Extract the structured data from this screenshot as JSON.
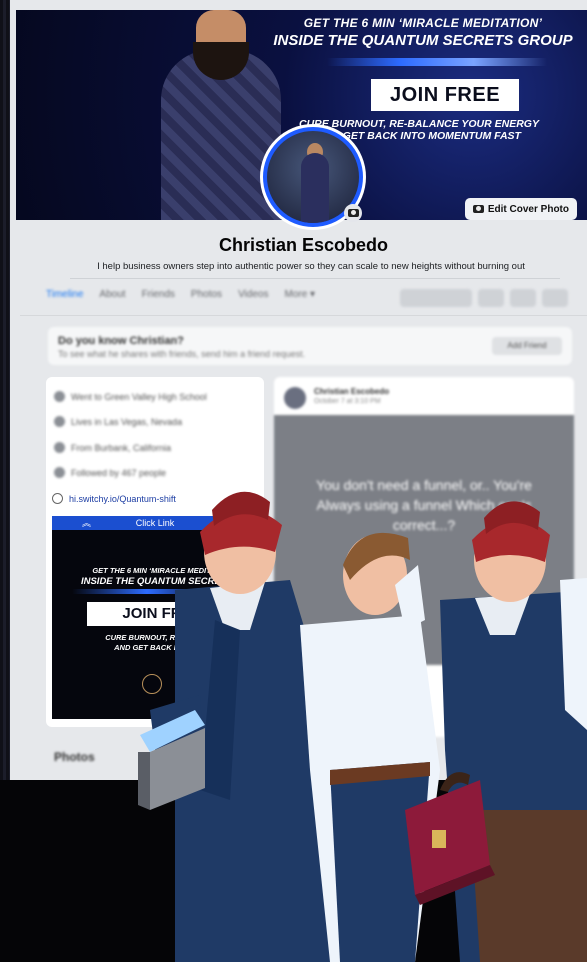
{
  "cover": {
    "headline_line1": "GET THE 6 MIN ‘MIRACLE MEDITATION’",
    "headline_line2_prefix": "INSIDE THE ",
    "headline_line2_highlight": "QUANTUM SECRETS GROUP",
    "join_label": "JOIN FREE",
    "sub_line1": "CURE BURNOUT, RE-BALANCE YOUR ENERGY",
    "sub_line2_prefix": "AND GET BACK INTO ",
    "sub_line2_highlight": "MOMENTUM FAST",
    "edit_button_label": "Edit Cover Photo"
  },
  "profile": {
    "name": "Christian Escobedo",
    "bio": "I help business owners step into authentic power so they can scale to new heights without burning out"
  },
  "tabs": [
    "Timeline",
    "About",
    "Friends",
    "Photos",
    "Videos",
    "More ▾"
  ],
  "know_card": {
    "title": "Do you know Christian?",
    "subtitle": "To see what he shares with friends, send him a friend request.",
    "button": "Add Friend"
  },
  "intro": {
    "items": [
      "Went to Green Valley High School",
      "Lives in Las Vegas, Nevada",
      "From Burbank, California",
      "Followed by 467 people"
    ],
    "link": "hi.switchy.io/Quantum-shift"
  },
  "promo": {
    "bar_label": "Click Link",
    "line1": "GET THE 6 MIN ‘MIRACLE MEDITATI",
    "line2": "INSIDE THE QUANTUM SECRETS G",
    "join_label": "JOIN FR",
    "line3": "CURE BURNOUT, RE-BALAN",
    "line4": "AND GET BACK INTO M"
  },
  "post": {
    "author": "Christian Escobedo",
    "date": "October 7 at 3:10 PM",
    "text": "You don't need a funnel, or.. You're Always using a funnel Which one's correct...?"
  },
  "photos_label": "Photos",
  "colors": {
    "accent": "#1877f2",
    "cover_blue": "#1b2c80",
    "promo_bar": "#1b4fd0",
    "turban": "#a8282c",
    "suit": "#1f3a66"
  }
}
